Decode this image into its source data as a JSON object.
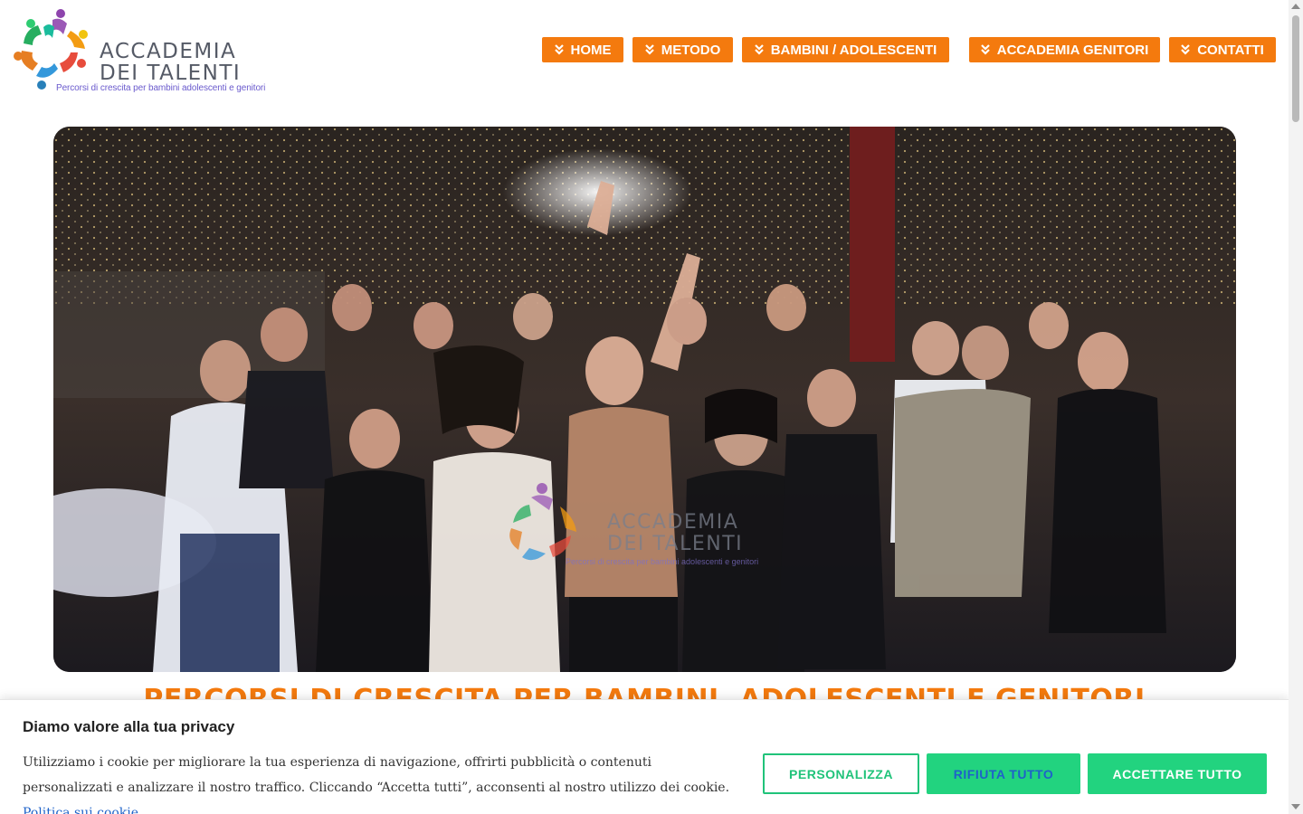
{
  "brand": {
    "name_line1": "ACCADEMIA",
    "name_line2": "DEI TALENTI",
    "tagline": "Percorsi di crescita per bambini adolescenti e genitori",
    "logo_icon": "people-circle-logo"
  },
  "nav": {
    "items": [
      {
        "label": "HOME",
        "icon": "chevron-double-down-icon"
      },
      {
        "label": "METODO",
        "icon": "chevron-double-down-icon"
      },
      {
        "label": "BAMBINI / ADOLESCENTI",
        "icon": "chevron-double-down-icon"
      },
      {
        "label": "ACCADEMIA GENITORI",
        "icon": "chevron-double-down-icon"
      },
      {
        "label": "CONTATTI",
        "icon": "chevron-double-down-icon"
      }
    ]
  },
  "hero": {
    "watermark_line1": "ACCADEMIA",
    "watermark_line2": "DEI TALENTI",
    "watermark_tagline": "Percorsi di crescita per bambini adolescenti e genitori"
  },
  "headline": "PERCORSI DI CRESCITA PER BAMBINI, ADOLESCENTI E GENITORI",
  "cookie": {
    "title": "Diamo valore alla tua privacy",
    "text": "Utilizziamo i cookie per migliorare la tua esperienza di navigazione, offrirti pubblicità o contenuti personalizzati e analizzare il nostro traffico. Cliccando “Accetta tutti”, acconsenti al nostro utilizzo dei cookie.",
    "link": "Politica sui cookie",
    "btn_customize": "PERSONALIZZA",
    "btn_reject": "RIFIUTA TUTTO",
    "btn_accept": "ACCETTARE TUTTO"
  },
  "colors": {
    "accent": "#f47a0e",
    "cookie_green": "#22d37f",
    "cookie_link": "#1e62c9"
  }
}
